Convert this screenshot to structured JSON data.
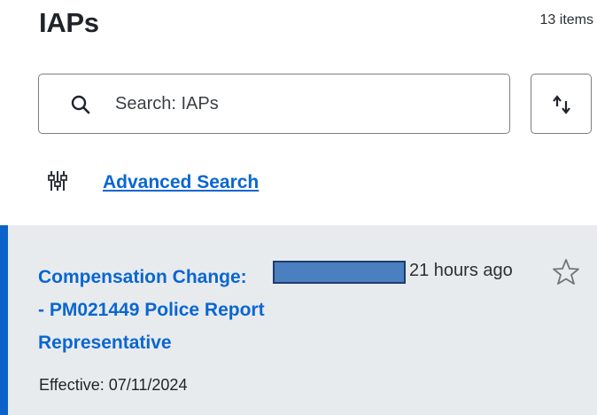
{
  "header": {
    "title": "IAPs",
    "count": "13 items"
  },
  "search": {
    "placeholder": "Search: IAPs",
    "icon": "search-icon"
  },
  "sort": {
    "icon": "sort-arrows-icon"
  },
  "advanced_search": {
    "label": "Advanced Search",
    "icon": "filter-sliders-icon"
  },
  "accent_color": "#0b63c9",
  "link_color": "#0a66d1",
  "list": {
    "items": [
      {
        "title_line1": "Compensation Change:",
        "title_line2": "- PM021449 Police Report",
        "title_line3": "Representative",
        "time": "21 hours ago",
        "effective": "Effective: 07/11/2024",
        "starred": false
      }
    ]
  }
}
